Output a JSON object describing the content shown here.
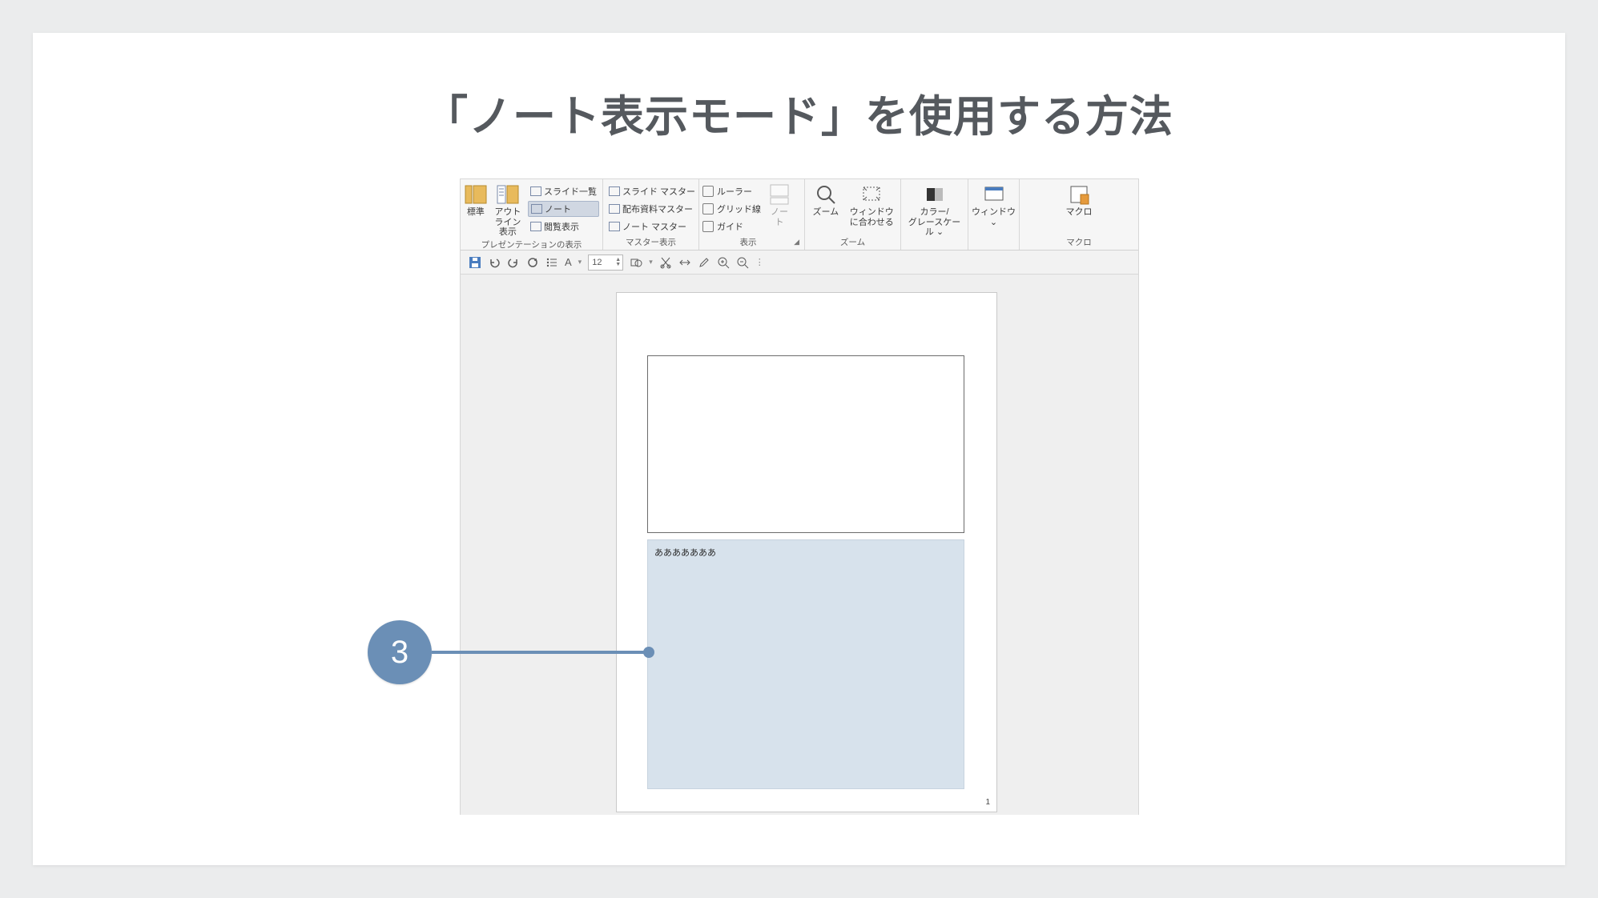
{
  "title": "「ノート表示モード」を使用する方法",
  "ribbon": {
    "presentation_views": {
      "label": "プレゼンテーションの表示",
      "normal": "標準",
      "outline": "アウトライン\n表示",
      "slide_sorter": "スライド一覧",
      "notes_page": "ノート",
      "reading_view": "閲覧表示"
    },
    "master_views": {
      "label": "マスター表示",
      "slide_master": "スライド マスター",
      "handout_master": "配布資料マスター",
      "notes_master": "ノート マスター"
    },
    "show": {
      "label": "表示",
      "ruler": "ルーラー",
      "gridlines": "グリッド線",
      "guides": "ガイド",
      "notes_btn": "ノー\nト"
    },
    "zoom": {
      "label": "ズーム",
      "zoom_btn": "ズーム",
      "fit_btn": "ウィンドウ\nに合わせる"
    },
    "color": {
      "label": "カラー/\nグレースケール ⌄"
    },
    "window": {
      "label": "ウィンドウ\n⌄"
    },
    "macro": {
      "group_label": "マクロ",
      "btn_label": "マクロ"
    }
  },
  "qat": {
    "font_label": "A",
    "font_size": "12"
  },
  "notes": {
    "text": "あああああああ",
    "page_number": "1"
  },
  "annotation": {
    "step": "3"
  }
}
